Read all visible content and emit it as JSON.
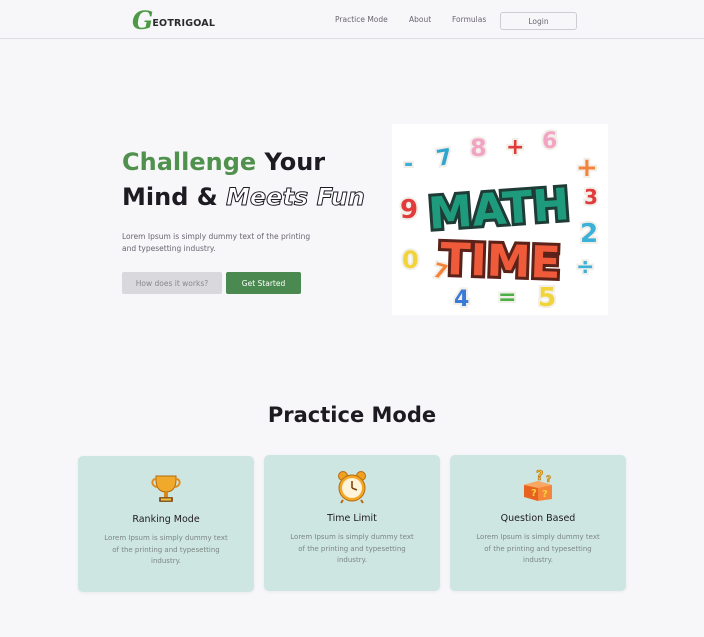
{
  "brand": {
    "logo_letter": "G",
    "logo_rest": "EOTRIGOAL"
  },
  "nav": {
    "links": [
      {
        "label": "Practice Mode"
      },
      {
        "label": "About"
      },
      {
        "label": "Formulas"
      }
    ],
    "login_label": "Login"
  },
  "hero": {
    "title_part1": "Challenge",
    "title_part2": " Your",
    "title_part3": "Mind & ",
    "title_part4": "Meets Fun",
    "description": "Lorem Ipsum is simply dummy text of the printing and typesetting industry.",
    "secondary_button": "How does it works?",
    "primary_button": "Get Started",
    "image": {
      "text_line1": "MATH",
      "text_line2": "TIME",
      "glyphs": [
        "-",
        "7",
        "8",
        "+",
        "6",
        "+",
        "9",
        "3",
        "2",
        "0",
        "7",
        "4",
        "=",
        "5",
        "÷"
      ]
    }
  },
  "practice": {
    "title": "Practice Mode",
    "cards": [
      {
        "title": "Ranking Mode",
        "description": "Lorem Ipsum is simply dummy text of the printing and typesetting industry.",
        "icon": "trophy-icon"
      },
      {
        "title": "Time Limit",
        "description": "Lorem Ipsum is simply dummy text of the printing and typesetting industry.",
        "icon": "alarm-clock-icon"
      },
      {
        "title": "Question Based",
        "description": "Lorem Ipsum is simply dummy text of the printing and typesetting industry.",
        "icon": "question-box-icon"
      }
    ]
  },
  "colors": {
    "brand_green": "#4f914d",
    "button_green": "#4a8a50",
    "card_bg": "#cee6e1",
    "page_bg": "#f7f6f9"
  }
}
